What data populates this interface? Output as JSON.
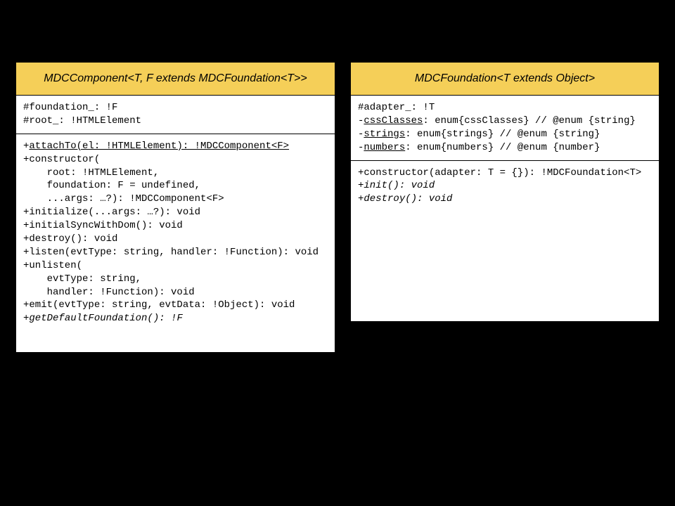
{
  "classes": {
    "left": {
      "title": "MDCComponent<T, F extends MDCFoundation<T>>",
      "attrs": {
        "l1": "#foundation_: !F",
        "l2": "#root_: !HTMLElement"
      },
      "methods": {
        "m1_pre": "+",
        "m1_u": "attachTo(el: !HTMLElement): !MDCComponent<F>",
        "m2": "+constructor(",
        "m3": "    root: !HTMLElement,",
        "m4": "    foundation: F = undefined,",
        "m5": "    ...args: …?): !MDCComponent<F>",
        "m6": "+initialize(...args: …?): void",
        "m7": "+initialSyncWithDom(): void",
        "m8": "+destroy(): void",
        "m9": "+listen(evtType: string, handler: !Function): void",
        "m10": "+unlisten(",
        "m11": "    evtType: string,",
        "m12": "    handler: !Function): void",
        "m13": "+emit(evtType: string, evtData: !Object): void",
        "m14_pre": "+",
        "m14_i": "getDefaultFoundation(): !F"
      }
    },
    "right": {
      "title": "MDCFoundation<T extends Object>",
      "attrs": {
        "l1": "#adapter_: !T",
        "l2_pre": "-",
        "l2_u": "cssClasses",
        "l2_post": ": enum{cssClasses} // @enum {string}",
        "l3_pre": "-",
        "l3_u": "strings",
        "l3_post": ": enum{strings} // @enum {string}",
        "l4_pre": "-",
        "l4_u": "numbers",
        "l4_post": ": enum{numbers} // @enum {number}"
      },
      "methods": {
        "m1": "+constructor(adapter: T = {}): !MDCFoundation<T>",
        "m2_pre": "+",
        "m2_i": "init(): void",
        "m3_pre": "+",
        "m3_i": "destroy(): void"
      }
    }
  }
}
